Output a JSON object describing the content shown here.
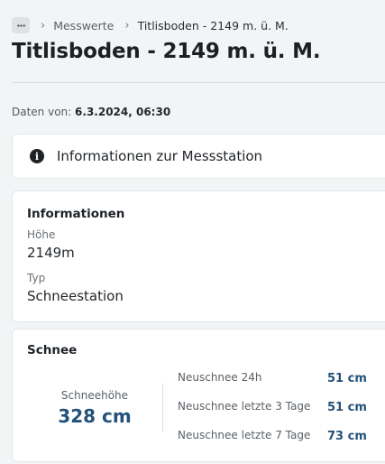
{
  "breadcrumb": {
    "more_label": "···",
    "items": [
      "Messwerte",
      "Titlisboden - 2149 m. ü. M."
    ]
  },
  "page_title": "Titlisboden - 2149 m. ü. M.",
  "data_date": {
    "label": "Daten von:",
    "value": "6.3.2024, 06:30"
  },
  "station_info_toggle": {
    "icon": "info-icon",
    "label": "Informationen zur Messstation"
  },
  "details": {
    "title": "Informationen",
    "fields": [
      {
        "label": "Höhe",
        "value": "2149m"
      },
      {
        "label": "Typ",
        "value": "Schneestation"
      }
    ]
  },
  "snow": {
    "title": "Schnee",
    "height_label": "Schneehöhe",
    "height_value": "328 cm",
    "stats": [
      {
        "label": "Neuschnee 24h",
        "value": "51 cm"
      },
      {
        "label": "Neuschnee letzte 3 Tage",
        "value": "51 cm"
      },
      {
        "label": "Neuschnee letzte 7 Tage",
        "value": "73 cm"
      }
    ]
  },
  "colors": {
    "accent": "#24527a",
    "background": "#f3f4f6",
    "card": "#ffffff"
  }
}
